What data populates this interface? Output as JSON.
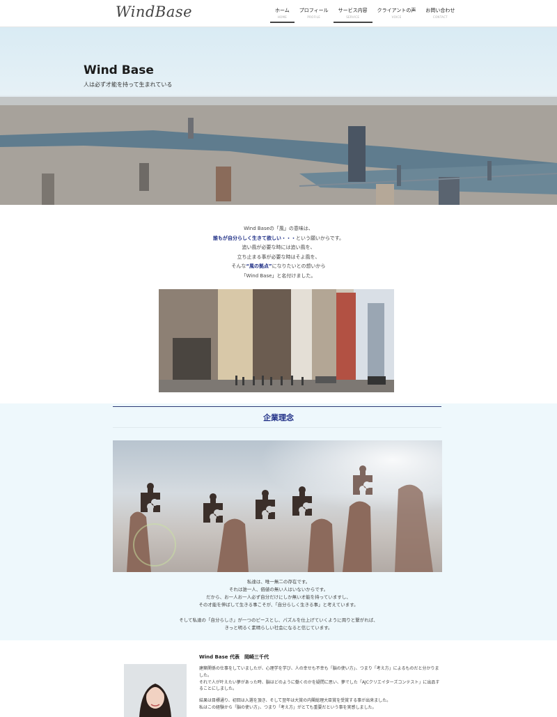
{
  "header": {
    "logo": "WindBase",
    "nav": [
      {
        "label": "ホーム",
        "sub": "HOME",
        "active": true
      },
      {
        "label": "プロフィール",
        "sub": "PROFILE",
        "active": false
      },
      {
        "label": "サービス内容",
        "sub": "SERVICE",
        "active": true
      },
      {
        "label": "クライアントの声",
        "sub": "VOICE",
        "active": false
      },
      {
        "label": "お問い合わせ",
        "sub": "CONTACT",
        "active": false
      }
    ]
  },
  "hero": {
    "title": "Wind Base",
    "subtitle": "人は必ず才能を持って生まれている"
  },
  "intro": {
    "line1": "Wind Baseの「風」の意味は、",
    "line2_highlight": "誰もが自分らしく生きて欲しい・・・",
    "line2_rest": "という願いからです。",
    "line3": "追い風が必要な時には追い風を、",
    "line4": "立ち止まる事が必要な時はそよ風を、",
    "line5_pre": "そんな",
    "line5_highlight": "“風の拠点”",
    "line5_post": "になりたいとの想いから",
    "line6": "「Wind Base」と名付けました。"
  },
  "philosophy": {
    "title": "企業理念",
    "lines": [
      "私達は、唯一無二の存在です。",
      "それは誰一人、価値の無い人はいないからです。",
      "だから、お一人お一人必ず自分だけにしか無い才能を持っていますし、",
      "その才能を伸ばして生きる事こそが、「自分らしく生きる事」と考えています。"
    ],
    "closing": [
      "そして私達の「自分らしさ」が一つのピースとし、パズルを仕上げていくように周りと繋がれば、",
      "きっと明るく素晴らしい社会になると信じています。"
    ]
  },
  "representative": {
    "title": "Wind Base 代表　岡崎三千代",
    "paragraphs": [
      "建築関係の仕事をしていましたが、心理学を学び、人の幸せも不幸も「脳の使い方」、つまり「考え方」によるものだと分かりました。",
      "それで人が叶えたい夢があった時、脳はどのように働くのかを疑問に思い、夢でした「AJCクリエイターズコンテスト」に出品することにしました。",
      "結果は目標通り、初回は入選を頂き、そして翌年は大賞の内閣総理大臣賞を受賞する事が出来ました。",
      "私はこの経験から「脳の使い方」、つまり「考え方」がとても重要だという事を実感しました。"
    ]
  },
  "colors": {
    "accent": "#1f2f86",
    "philosophy_bg": "#eef8fc"
  }
}
